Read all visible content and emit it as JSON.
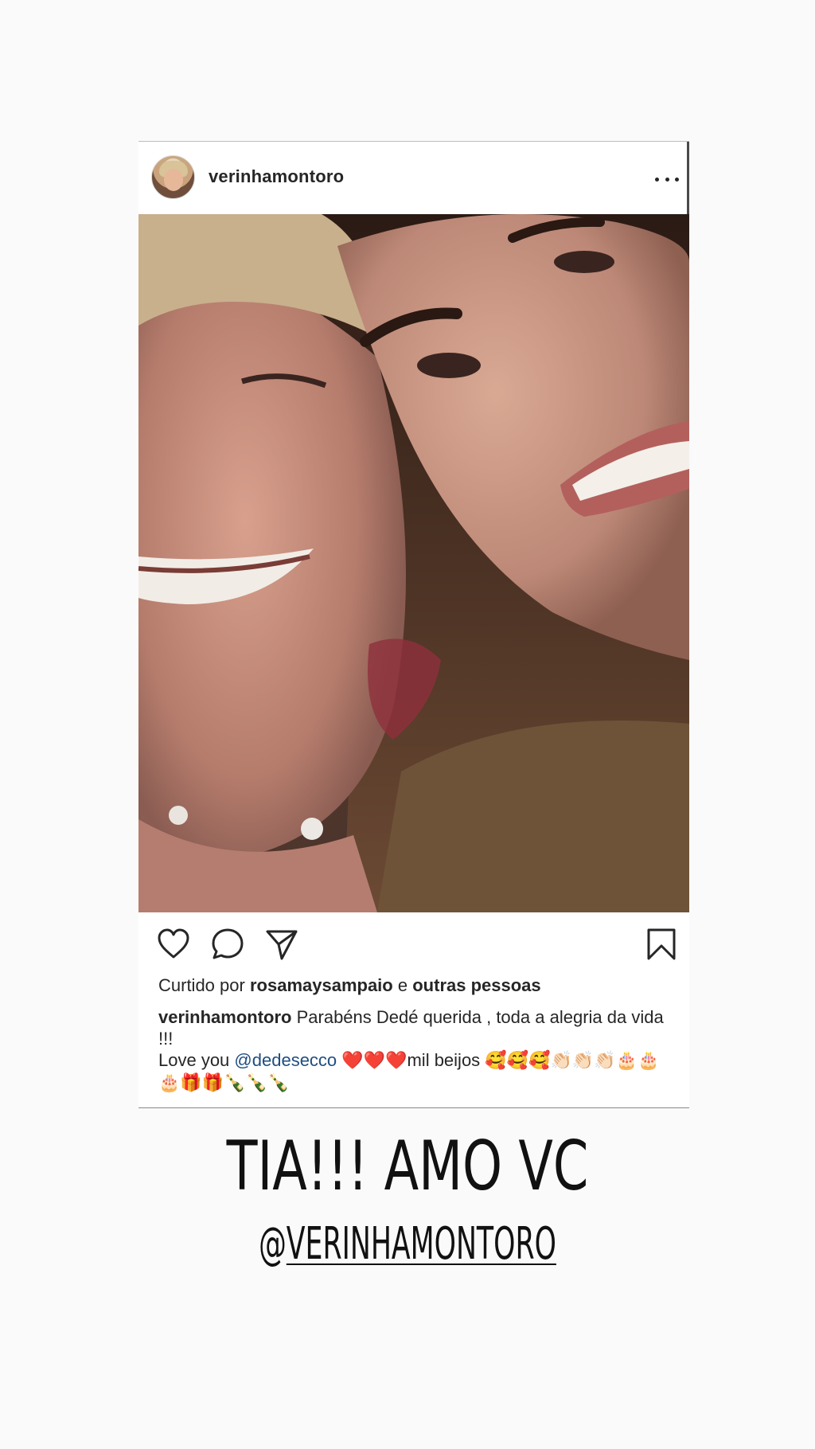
{
  "post": {
    "username": "verinhamontoro",
    "more_icon": "more-options-icon",
    "likes": {
      "prefix": "Curtido por",
      "user": "rosamaysampaio",
      "joiner": "e",
      "others": "outras pessoas"
    },
    "caption": {
      "author": "verinhamontoro",
      "line1": "Parabéns Dedé querida , toda a alegria da vida !!!",
      "love": "Love you",
      "mention": "@dedesecco",
      "hearts": "❤️❤️❤️",
      "beijos": "mil beijos",
      "emojis_end": "🥰🥰🥰👏🏻👏🏻👏🏻🎂🎂🎂🎁🎁🍾🍾🍾"
    },
    "icons": {
      "like": "heart-icon",
      "comment": "comment-icon",
      "share": "paper-plane-icon",
      "save": "bookmark-icon"
    }
  },
  "story": {
    "headline": "TIA!!! AMO VC",
    "handle_at": "@",
    "handle_name": "VERINHAMONTORO"
  },
  "colors": {
    "background": "#fafafa",
    "text": "#262626",
    "mention": "#1f4d80"
  }
}
